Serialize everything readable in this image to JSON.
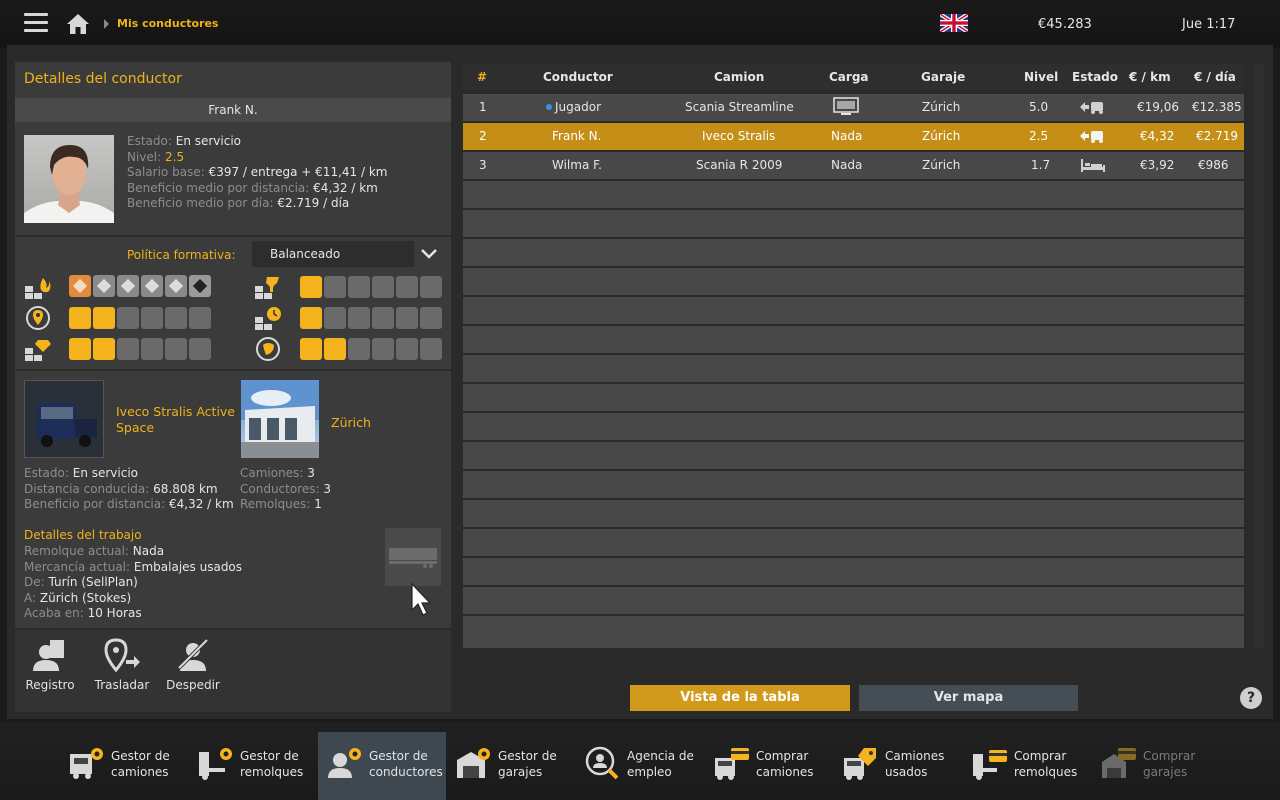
{
  "topbar": {
    "breadcrumb": "Mis conductores",
    "money": "€45.283",
    "clock": "Jue 1:17"
  },
  "driver": {
    "panel_title": "Detalles del conductor",
    "name": "Frank N.",
    "estado_lbl": "Estado:",
    "estado_val": "En servicio",
    "nivel_lbl": "Nivel:",
    "nivel_val": "2.5",
    "salario_lbl": "Salario base:",
    "salario_val": "€397 / entrega + €11,41 / km",
    "benef_dist_lbl": "Beneficio medio por distancia:",
    "benef_dist_val": "€4,32 / km",
    "benef_dia_lbl": "Beneficio medio por día:",
    "benef_dia_val": "€2.719 / día"
  },
  "policy": {
    "label": "Política formativa:",
    "value": "Balanceado"
  },
  "skills": {
    "adr_active": 0,
    "long_distance": 2,
    "high_value": 2,
    "fragile": 1,
    "just_in_time": 1,
    "eco_driving": 2
  },
  "truck": {
    "name": "Iveco Stralis Active Space",
    "estado_lbl": "Estado:",
    "estado_val": "En servicio",
    "dist_lbl": "Distancia conducida:",
    "dist_val": "68.808 km",
    "benef_lbl": "Beneficio por distancia:",
    "benef_val": "€4,32 / km"
  },
  "garage": {
    "name": "Zürich",
    "camiones_lbl": "Camiones:",
    "camiones_val": "3",
    "conductores_lbl": "Conductores:",
    "conductores_val": "3",
    "remolques_lbl": "Remolques:",
    "remolques_val": "1"
  },
  "job": {
    "title": "Detalles del trabajo",
    "remolque_lbl": "Remolque actual:",
    "remolque_val": "Nada",
    "mercancia_lbl": "Mercancía actual:",
    "mercancia_val": "Embalajes usados",
    "de_lbl": "De:",
    "de_val": "Turín (SellPlan)",
    "a_lbl": "A:",
    "a_val": "Zürich (Stokes)",
    "acaba_lbl": "Acaba en:",
    "acaba_val": "10 Horas"
  },
  "actions": {
    "registro": "Registro",
    "trasladar": "Trasladar",
    "despedir": "Despedir"
  },
  "table": {
    "headers": {
      "num": "#",
      "conductor": "Conductor",
      "camion": "Camion",
      "carga": "Carga",
      "garaje": "Garaje",
      "nivel": "Nivel",
      "estado": "Estado",
      "eur_km": "€ / km",
      "eur_dia": "€ / día"
    },
    "rows": [
      {
        "num": "1",
        "conductor": "Jugador",
        "camion": "Scania Streamline",
        "carga": "",
        "garaje": "Zúrich",
        "nivel": "5.0",
        "eur_km": "€19,06",
        "eur_dia": "€12.385"
      },
      {
        "num": "2",
        "conductor": "Frank N.",
        "camion": "Iveco Stralis",
        "carga": "Nada",
        "garaje": "Zúrich",
        "nivel": "2.5",
        "eur_km": "€4,32",
        "eur_dia": "€2.719"
      },
      {
        "num": "3",
        "conductor": "Wilma F.",
        "camion": "Scania R 2009",
        "carga": "Nada",
        "garaje": "Zúrich",
        "nivel": "1.7",
        "eur_km": "€3,92",
        "eur_dia": "€986"
      }
    ]
  },
  "view_buttons": {
    "table": "Vista de la tabla",
    "map": "Ver mapa",
    "help": "?"
  },
  "bottom_nav": {
    "gestor_camiones": "Gestor de camiones",
    "gestor_remolques": "Gestor de remolques",
    "gestor_conductores": "Gestor de conductores",
    "gestor_garajes": "Gestor de garajes",
    "agencia_empleo": "Agencia de empleo",
    "comprar_camiones": "Comprar camiones",
    "camiones_usados": "Camiones usados",
    "comprar_remolques": "Comprar remolques",
    "comprar_garajes": "Comprar garajes"
  },
  "colors": {
    "accent": "#f0b21b",
    "selected_row": "#c58f17",
    "active_nav": "#3d4850"
  }
}
